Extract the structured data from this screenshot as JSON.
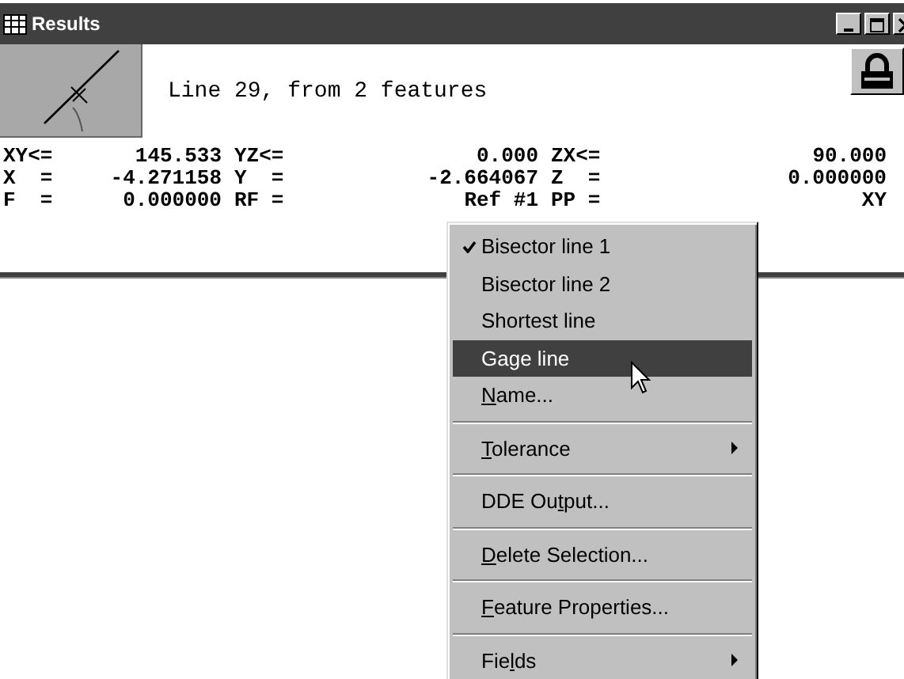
{
  "window": {
    "title": "Results"
  },
  "heading": "Line 29, from 2 features",
  "rows": [
    [
      {
        "label": "XY<=",
        "value": "145.533"
      },
      {
        "label": "YZ<=",
        "value": "0.000"
      },
      {
        "label": "ZX<=",
        "value": "90.000"
      }
    ],
    [
      {
        "label": "X  =",
        "value": "-4.271158"
      },
      {
        "label": "Y  =",
        "value": "-2.664067"
      },
      {
        "label": "Z  =",
        "value": "0.000000"
      }
    ],
    [
      {
        "label": "F  =",
        "value": "0.000000"
      },
      {
        "label": "RF =",
        "value": "Ref #1"
      },
      {
        "label": "PP =",
        "value": "XY"
      }
    ]
  ],
  "context_menu": {
    "items": [
      {
        "kind": "item",
        "label": "Bisector line 1",
        "checked": true,
        "selected": false
      },
      {
        "kind": "item",
        "label": "Bisector line 2",
        "checked": false,
        "selected": false
      },
      {
        "kind": "item",
        "label": "Shortest line",
        "checked": false,
        "selected": false
      },
      {
        "kind": "item",
        "label": "Gage line",
        "checked": false,
        "selected": true
      },
      {
        "kind": "item",
        "access_key": "N",
        "label_end": "ame...",
        "checked": false,
        "selected": false
      },
      {
        "kind": "separator"
      },
      {
        "kind": "submenu",
        "access_key": "T",
        "label_end": "olerance",
        "checked": false,
        "selected": false
      },
      {
        "kind": "separator"
      },
      {
        "kind": "item",
        "label_start": "DDE Ou",
        "access_key": "t",
        "label_end": "put...",
        "checked": false,
        "selected": false
      },
      {
        "kind": "separator"
      },
      {
        "kind": "item",
        "access_key": "D",
        "label_end": "elete Selection...",
        "checked": false,
        "selected": false
      },
      {
        "kind": "separator"
      },
      {
        "kind": "item",
        "access_key": "F",
        "label_end": "eature Properties...",
        "checked": false,
        "selected": false
      },
      {
        "kind": "separator"
      },
      {
        "kind": "submenu",
        "label_start": "Fie",
        "access_key": "l",
        "label_end": "ds",
        "checked": false,
        "selected": false
      }
    ]
  }
}
